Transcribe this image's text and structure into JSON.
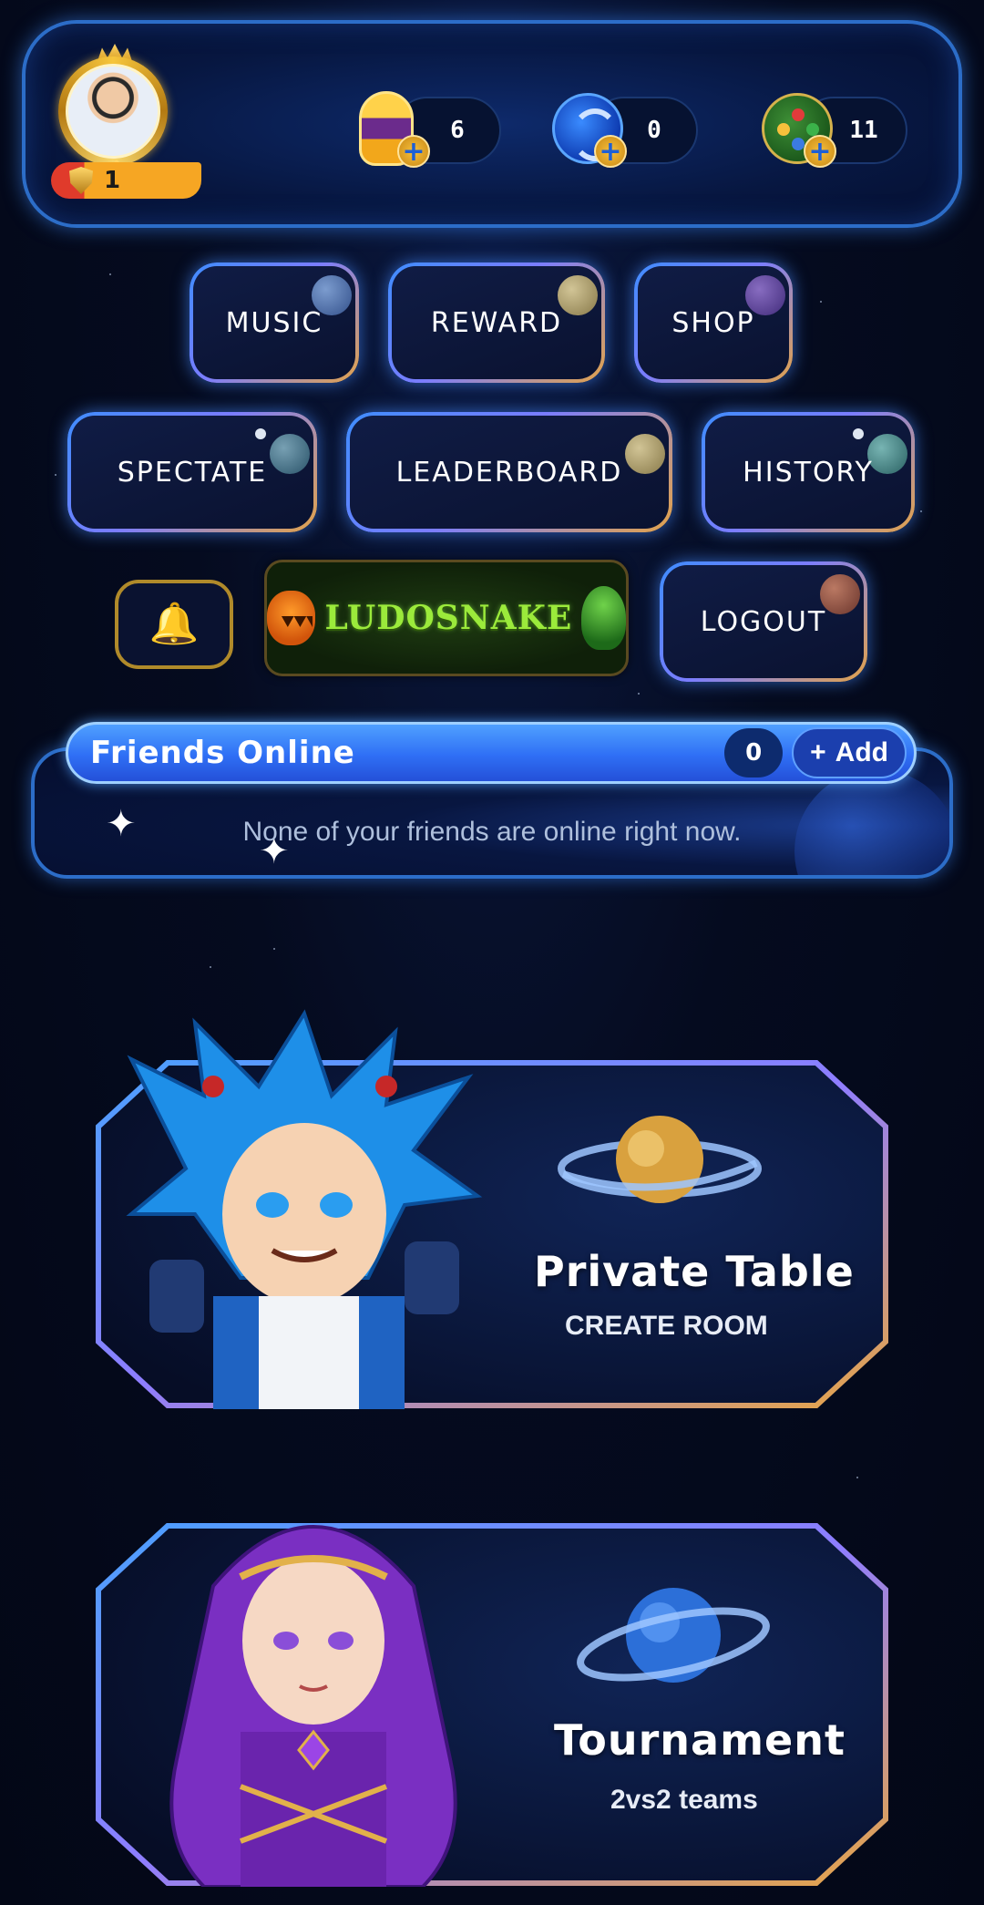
{
  "player": {
    "level": "1"
  },
  "currencies": [
    {
      "icon": "gem-capsule-icon",
      "amount": "6"
    },
    {
      "icon": "steem-coin-icon",
      "amount": "0"
    },
    {
      "icon": "game-coin-icon",
      "amount": "11"
    }
  ],
  "menu": {
    "music": "MUSIC",
    "reward": "REWARD",
    "shop": "SHOP",
    "spectate": "SPECTATE",
    "leaderboard": "LEADERBOARD",
    "history": "HISTORY",
    "logout": "LOGOUT"
  },
  "logo": {
    "text": "LUDOSNAKE"
  },
  "friends": {
    "title": "Friends Online",
    "count": "0",
    "add_label": "Add",
    "empty_message": "None of your friends are online right now."
  },
  "cards": {
    "private": {
      "title": "Private Table",
      "subtitle": "CREATE ROOM"
    },
    "tournament": {
      "title": "Tournament",
      "subtitle": "2vs2 teams"
    }
  },
  "colors": {
    "accent_blue": "#3f8dff",
    "accent_gold": "#e3a34a",
    "background": "#050b1f"
  }
}
